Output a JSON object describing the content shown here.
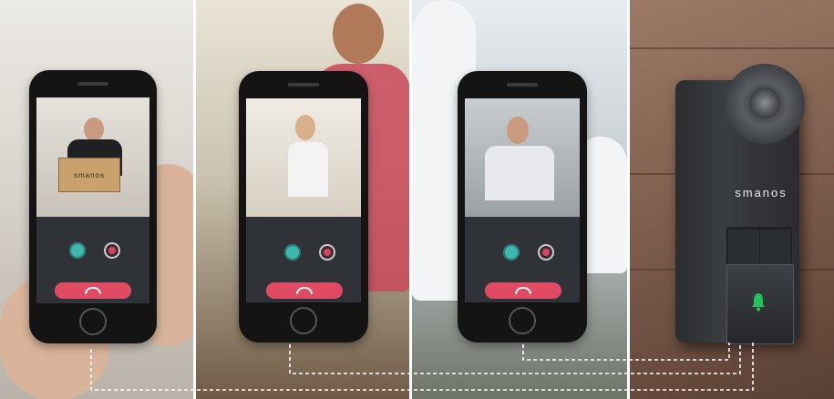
{
  "device": {
    "brand": "smanos"
  },
  "panels": [
    {
      "id": "delivery",
      "box_label": "smanos"
    },
    {
      "id": "runner"
    },
    {
      "id": "golfer"
    },
    {
      "id": "doorbell"
    }
  ],
  "colors": {
    "accept": "#3fb7ad",
    "record": "#d6445e",
    "hangup": "#e04b63",
    "bell": "#22c35e"
  },
  "icons": [
    "answer-icon",
    "record-icon",
    "hang-up-icon",
    "bell-icon",
    "camera-icon"
  ]
}
